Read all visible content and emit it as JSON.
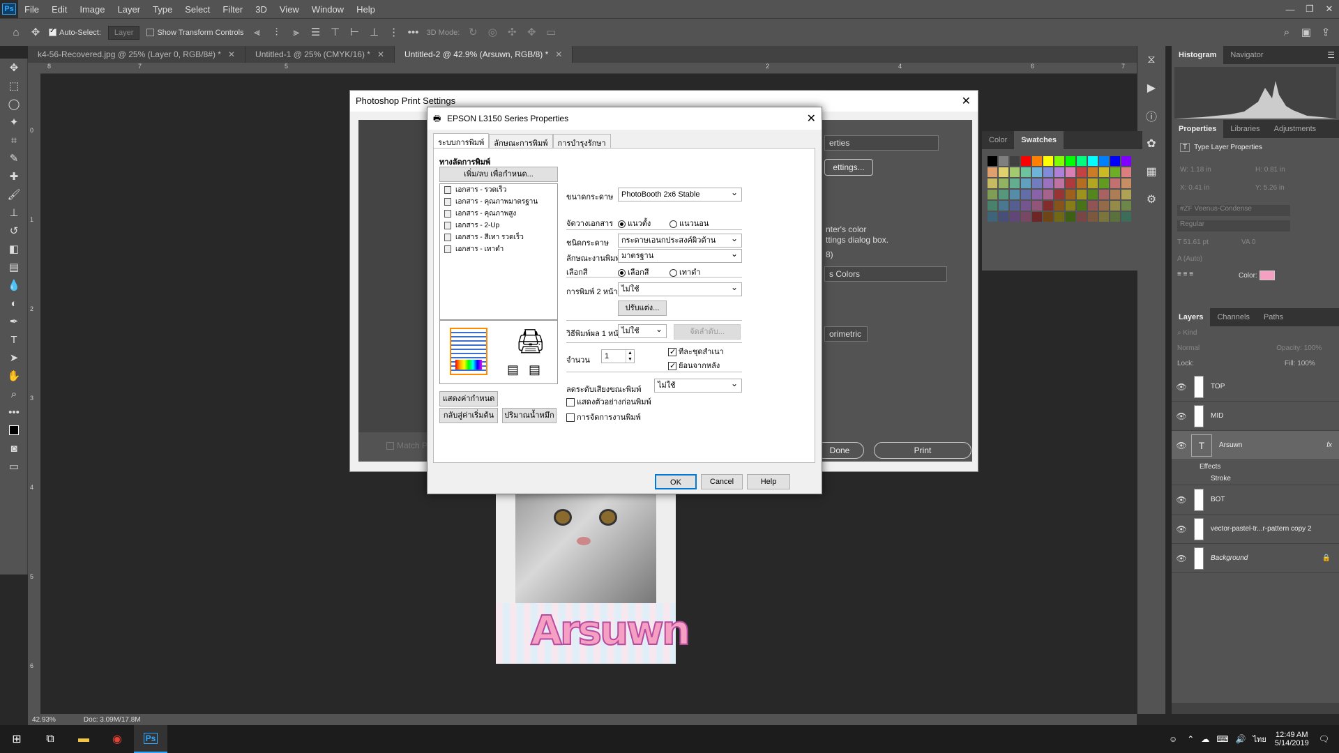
{
  "menu": {
    "logo": "Ps",
    "items": [
      "File",
      "Edit",
      "Image",
      "Layer",
      "Type",
      "Select",
      "Filter",
      "3D",
      "View",
      "Window",
      "Help"
    ]
  },
  "options": {
    "auto_select": "Auto-Select:",
    "auto_select_target": "Layer",
    "show_transform": "Show Transform Controls",
    "mode_3d": "3D Mode:"
  },
  "tabs": [
    {
      "label": "k4-56-Recovered.jpg @ 25% (Layer 0, RGB/8#) *"
    },
    {
      "label": "Untitled-1 @ 25% (CMYK/16) *"
    },
    {
      "label": "Untitled-2 @ 42.9% (Arsuwn, RGB/8) *"
    }
  ],
  "ruler": {
    "h": [
      "8",
      "7",
      "6",
      "5",
      "4",
      "3",
      "2",
      "1",
      "0",
      "1",
      "2",
      "3",
      "4",
      "5",
      "6",
      "7"
    ],
    "v": [
      "0",
      "1",
      "2",
      "3",
      "4",
      "5",
      "6"
    ]
  },
  "status": {
    "zoom": "42.93%",
    "doc": "Doc: 3.09M/17.8M"
  },
  "print_settings": {
    "title": "Photoshop Print Settings",
    "printer_partial": "erties",
    "settings_btn": "ettings...",
    "text1": "nter's color",
    "text2": "ttings dialog box.",
    "text3": "8)",
    "color_sel": "s Colors",
    "intent_sel": "orimetric",
    "match": "Match P",
    "done": "Done",
    "print": "Print"
  },
  "epson": {
    "title": "EPSON L3150 Series Properties",
    "tabs": [
      "ระบบการพิมพ์",
      "ลักษณะการพิมพ์",
      "การบำรุงรักษา"
    ],
    "preset_heading": "ทางลัดการพิมพ์",
    "add_remove_btn": "เพิ่ม/ลบ เพื่อกำหนด...",
    "presets": [
      "เอกสาร - รวดเร็ว",
      "เอกสาร - คุณภาพมาตรฐาน",
      "เอกสาร - คุณภาพสูง",
      "เอกสาร - 2-Up",
      "เอกสาร - สีเทา รวดเร็ว",
      "เอกสาร - เทาดำ"
    ],
    "show_settings_btn": "แสดงค่ากำหนด",
    "reset_btn": "กลับสู่ค่าเริ่มต้น",
    "ink_btn": "ปริมาณน้ำหมึก",
    "paper_size_label": "ขนาดกระดาษ",
    "paper_size": "PhotoBooth 2x6 Stable",
    "orientation_label": "จัดวางเอกสาร",
    "portrait": "แนวตั้ง",
    "landscape": "แนวนอน",
    "paper_type_label": "ชนิดกระดาษ",
    "paper_type": "กระดาษเอนกประสงค์ผิวด้าน",
    "quality_label": "ลักษณะงานพิมพ์",
    "quality": "มาตรฐาน",
    "color_label": "เลือกสี",
    "color": "เลือกสี",
    "gray": "เทาดำ",
    "duplex_label": "การพิมพ์ 2 หน้า",
    "duplex": "ไม่ใช้",
    "adjust_btn": "ปรับแต่ง...",
    "multipage_label": "วิธีพิมพ์ผล 1 หน้า",
    "multipage": "ไม่ใช้",
    "order_btn": "จัดลำดับ...",
    "copies_label": "จำนวน",
    "copies": "1",
    "collate": "ทีละชุดสำเนา",
    "reverse": "ย้อนจากหลัง",
    "quiet_label": "ลดระดับเสียงขณะพิมพ์",
    "quiet": "ไม่ใช้",
    "preview": "แสดงตัวอย่างก่อนพิมพ์",
    "job_arranger": "การจัดการงานพิมพ์",
    "ok": "OK",
    "cancel": "Cancel",
    "help": "Help"
  },
  "panels": {
    "histogram_tabs": [
      "Histogram",
      "Navigator"
    ],
    "color_tabs": [
      "Color",
      "Swatches"
    ],
    "prop_tabs": [
      "Properties",
      "Libraries",
      "Adjustments"
    ],
    "prop_title": "Type Layer Properties",
    "w": "W:",
    "w_val": "1.18 in",
    "h": "H:",
    "h_val": "0.81 in",
    "x": "X:",
    "x_val": "0.41 in",
    "y": "Y:",
    "y_val": "5.26 in",
    "font": "#ZF Veenus-Condense",
    "style": "Regular",
    "size": "51.61 pt",
    "leading": "(Auto)",
    "tracking": "0",
    "color_label": "Color:",
    "layer_tabs": [
      "Layers",
      "Channels",
      "Paths"
    ],
    "kind": "Kind",
    "blend": "Normal",
    "opacity_label": "Opacity:",
    "opacity": "100%",
    "lock_label": "Lock:",
    "fill_label": "Fill:",
    "fill": "100%",
    "layers": [
      "TOP",
      "MID",
      "Arsuwn",
      "BOT",
      "vector-pastel-tr...r-pattern copy 2",
      "Background"
    ],
    "effects": "Effects",
    "stroke": "Stroke",
    "fx": "fx"
  },
  "doc_text": "Arsuwn",
  "taskbar": {
    "time": "12:49 AM",
    "date": "5/14/2019",
    "lang": "ไทย"
  },
  "colors": {
    "accent": "#31a8ff",
    "pink": "#f59fc3"
  }
}
